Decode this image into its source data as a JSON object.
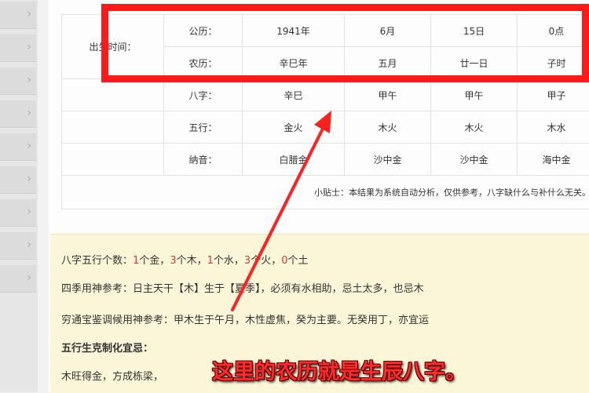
{
  "birth_table": {
    "birth_time_label": "出生时间：",
    "solar": {
      "label": "公历：",
      "year": "1941年",
      "month": "6月",
      "day": "15日",
      "hour": "0点"
    },
    "lunar": {
      "label": "农历：",
      "year": "辛巳年",
      "month": "五月",
      "day": "廿一日",
      "hour": "子时"
    },
    "bazi": {
      "label": "八字：",
      "year": "辛巳",
      "month": "甲午",
      "day": "甲午",
      "hour": "甲子"
    },
    "wuxing": {
      "label": "五行：",
      "year": "金火",
      "month": "木火",
      "day": "木火",
      "hour": "木水"
    },
    "nayin": {
      "label": "纳音：",
      "year": "白腊金",
      "month": "沙中金",
      "day": "沙中金",
      "hour": "海中金"
    },
    "tip": "小贴士：本结果为系统自动分析，仅供参考，八字缺什么与补什么无关。"
  },
  "analysis": {
    "counts_label": "八字五行个数：",
    "counts": [
      {
        "num": "1",
        "text": "个金，"
      },
      {
        "num": "3",
        "text": "个木，"
      },
      {
        "num": "1",
        "text": "个水，"
      },
      {
        "num": "3",
        "text": "个火，"
      },
      {
        "num": "0",
        "text": "个土"
      }
    ],
    "season_line": "四季用神参考：日主天干【木】生于【夏季】，必须有水相助，忌土太多，也忌木",
    "qiongtong_line": "穷通宝鉴调候用神参考：甲木生于午月，木性虚焦，癸为主要。无癸用丁，亦宜运",
    "section_title": "五行生克制化宜忌：",
    "partial_line": "木旺得金，方成栋梁，"
  },
  "annotation": {
    "caption": "这里的农历就是生辰八字。",
    "color": "#ff1a1a"
  }
}
